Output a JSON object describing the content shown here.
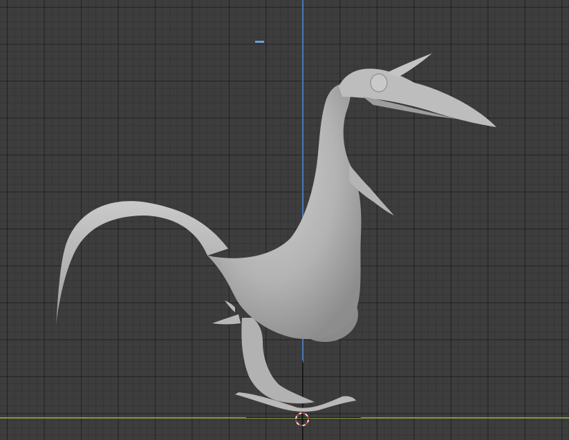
{
  "viewport": {
    "background_color": "#3d3d3d",
    "grid_major_color": "#262626",
    "axis_z_color": "#4a78b5",
    "axis_x_color": "#7f9a3c",
    "mesh_color": "#b8b8b8",
    "cursor_colors": [
      "#e8e8e8",
      "#d93c3c"
    ]
  },
  "scene": {
    "object": "creature-sculpt-mesh",
    "cursor": "3d-cursor-icon",
    "empty": "empty-marker-icon"
  }
}
